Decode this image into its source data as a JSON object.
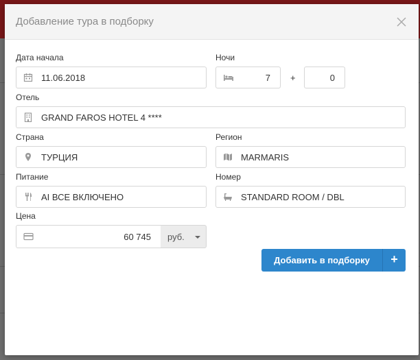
{
  "modal": {
    "title": "Добавление тура в подборку",
    "close_icon": "close-icon"
  },
  "form": {
    "start_date": {
      "label": "Дата начала",
      "value": "11.06.2018",
      "icon": "calendar-icon"
    },
    "nights": {
      "label": "Ночи",
      "value": "7",
      "plus": "+",
      "extra_value": "0",
      "icon": "bed-icon"
    },
    "hotel": {
      "label": "Отель",
      "value": "GRAND FAROS HOTEL 4 ****",
      "icon": "building-icon"
    },
    "country": {
      "label": "Страна",
      "value": "ТУРЦИЯ",
      "icon": "map-marker-icon"
    },
    "region": {
      "label": "Регион",
      "value": "MARMARIS",
      "icon": "map-icon"
    },
    "meal": {
      "label": "Питание",
      "value": "AI ВСЕ ВКЛЮЧЕНО",
      "icon": "cutlery-icon"
    },
    "room": {
      "label": "Номер",
      "value": "STANDARD ROOM / DBL",
      "icon": "bath-icon"
    },
    "price": {
      "label": "Цена",
      "value": "60 745",
      "currency": "руб.",
      "icon": "credit-card-icon"
    }
  },
  "actions": {
    "add_label": "Добавить в подборку",
    "add_plus": "+"
  },
  "colors": {
    "primary": "#2d86cc",
    "header_bg": "#f4f4f4",
    "topbar": "#7a1718"
  }
}
